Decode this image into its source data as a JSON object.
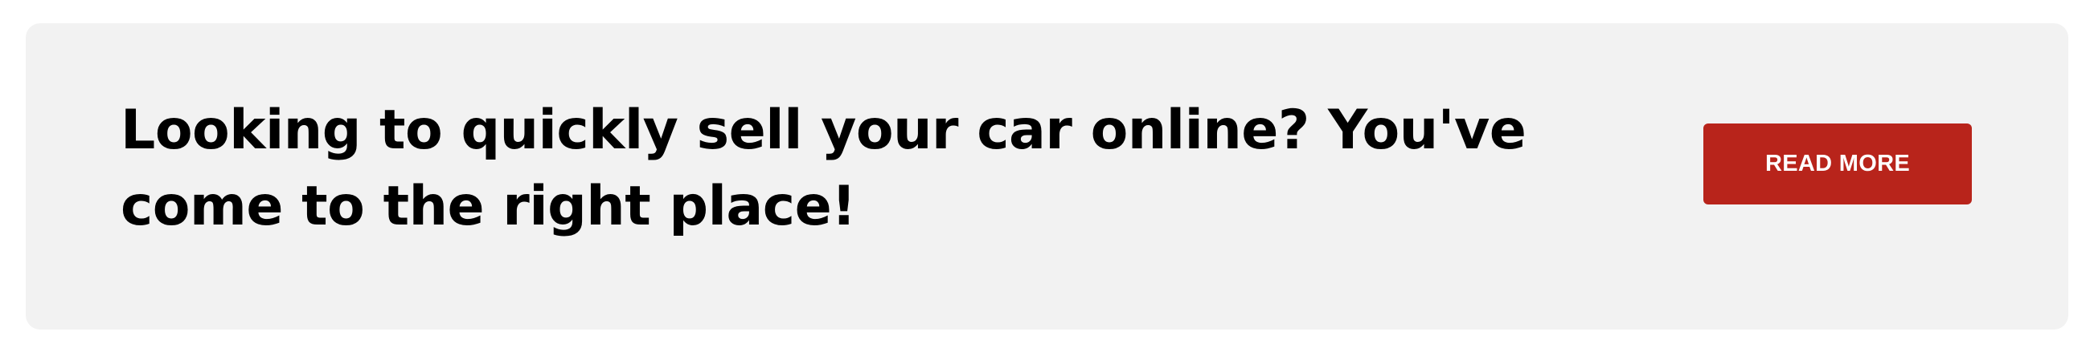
{
  "banner": {
    "headline": "Looking to quickly sell your car online? You've come to the right place!",
    "button_label": "READ MORE",
    "background_color": "#f2f2f2",
    "button_color": "#b8241b"
  }
}
